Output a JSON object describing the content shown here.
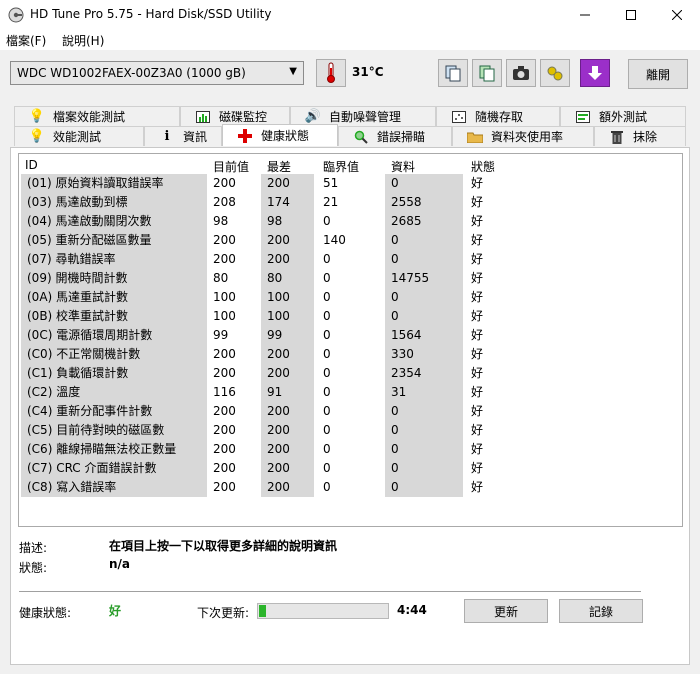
{
  "window": {
    "title": "HD Tune Pro 5.75 - Hard Disk/SSD Utility"
  },
  "menu": [
    {
      "label": "檔案(F)"
    },
    {
      "label": "說明(H)"
    }
  ],
  "toolbar": {
    "drive": "WDC WD1002FAEX-00Z3A0 (1000 gB)",
    "temperature": "31",
    "exit_label": "離開",
    "icons": [
      "thermometer-icon",
      "copy-icon",
      "copy-all-icon",
      "camera-icon",
      "tool-icon",
      "save-icon"
    ]
  },
  "tabs_row1": [
    {
      "label": "檔案效能測試",
      "icon": "file-bench-icon"
    },
    {
      "label": "磁碟監控",
      "icon": "chart-icon"
    },
    {
      "label": "自動噪聲管理",
      "icon": "speaker-icon"
    },
    {
      "label": "隨機存取",
      "icon": "random-access-icon"
    },
    {
      "label": "額外測試",
      "icon": "extra-test-icon"
    }
  ],
  "tabs_row2": [
    {
      "label": "效能測試",
      "icon": "lightbulb-icon"
    },
    {
      "label": "資訊",
      "icon": "info-icon"
    },
    {
      "label": "健康狀態",
      "icon": "health-cross-icon"
    },
    {
      "label": "錯誤掃瞄",
      "icon": "magnifier-icon"
    },
    {
      "label": "資料夾使用率",
      "icon": "folder-icon"
    },
    {
      "label": "抹除",
      "icon": "trash-icon"
    }
  ],
  "table": {
    "columns": [
      "ID",
      "目前值",
      "最差",
      "臨界值",
      "資料",
      "狀態"
    ],
    "rows": [
      {
        "id": "(01) 原始資料讀取錯誤率",
        "current": "200",
        "worst": "200",
        "threshold": "51",
        "data": "0",
        "status": "好"
      },
      {
        "id": "(03) 馬達啟動到標",
        "current": "208",
        "worst": "174",
        "threshold": "21",
        "data": "2558",
        "status": "好"
      },
      {
        "id": "(04) 馬達啟動關閉次數",
        "current": "98",
        "worst": "98",
        "threshold": "0",
        "data": "2685",
        "status": "好"
      },
      {
        "id": "(05) 重新分配磁區數量",
        "current": "200",
        "worst": "200",
        "threshold": "140",
        "data": "0",
        "status": "好"
      },
      {
        "id": "(07) 尋軌錯誤率",
        "current": "200",
        "worst": "200",
        "threshold": "0",
        "data": "0",
        "status": "好"
      },
      {
        "id": "(09) 開機時間計數",
        "current": "80",
        "worst": "80",
        "threshold": "0",
        "data": "14755",
        "status": "好"
      },
      {
        "id": "(0A) 馬達重試計數",
        "current": "100",
        "worst": "100",
        "threshold": "0",
        "data": "0",
        "status": "好"
      },
      {
        "id": "(0B) 校準重試計數",
        "current": "100",
        "worst": "100",
        "threshold": "0",
        "data": "0",
        "status": "好"
      },
      {
        "id": "(0C) 電源循環周期計數",
        "current": "99",
        "worst": "99",
        "threshold": "0",
        "data": "1564",
        "status": "好"
      },
      {
        "id": "(C0) 不正常關機計數",
        "current": "200",
        "worst": "200",
        "threshold": "0",
        "data": "330",
        "status": "好"
      },
      {
        "id": "(C1) 負載循環計數",
        "current": "200",
        "worst": "200",
        "threshold": "0",
        "data": "2354",
        "status": "好"
      },
      {
        "id": "(C2) 溫度",
        "current": "116",
        "worst": "91",
        "threshold": "0",
        "data": "31",
        "status": "好"
      },
      {
        "id": "(C4) 重新分配事件計數",
        "current": "200",
        "worst": "200",
        "threshold": "0",
        "data": "0",
        "status": "好"
      },
      {
        "id": "(C5) 目前待對映的磁區數",
        "current": "200",
        "worst": "200",
        "threshold": "0",
        "data": "0",
        "status": "好"
      },
      {
        "id": "(C6) 離線掃瞄無法校正數量",
        "current": "200",
        "worst": "200",
        "threshold": "0",
        "data": "0",
        "status": "好"
      },
      {
        "id": "(C7) CRC 介面錯誤計數",
        "current": "200",
        "worst": "200",
        "threshold": "0",
        "data": "0",
        "status": "好"
      },
      {
        "id": "(C8) 寫入錯誤率",
        "current": "200",
        "worst": "200",
        "threshold": "0",
        "data": "0",
        "status": "好"
      }
    ]
  },
  "details": {
    "desc_label": "描述:",
    "desc_value": "在項目上按一下以取得更多詳細的說明資訊",
    "status_label": "狀態:",
    "status_value": "n/a"
  },
  "footer": {
    "health_label": "健康狀態:",
    "health_value": "好",
    "next_update_label": "下次更新:",
    "next_update_time": "4:44",
    "progress_fraction": 0.05,
    "update_button": "更新",
    "log_button": "記錄"
  }
}
